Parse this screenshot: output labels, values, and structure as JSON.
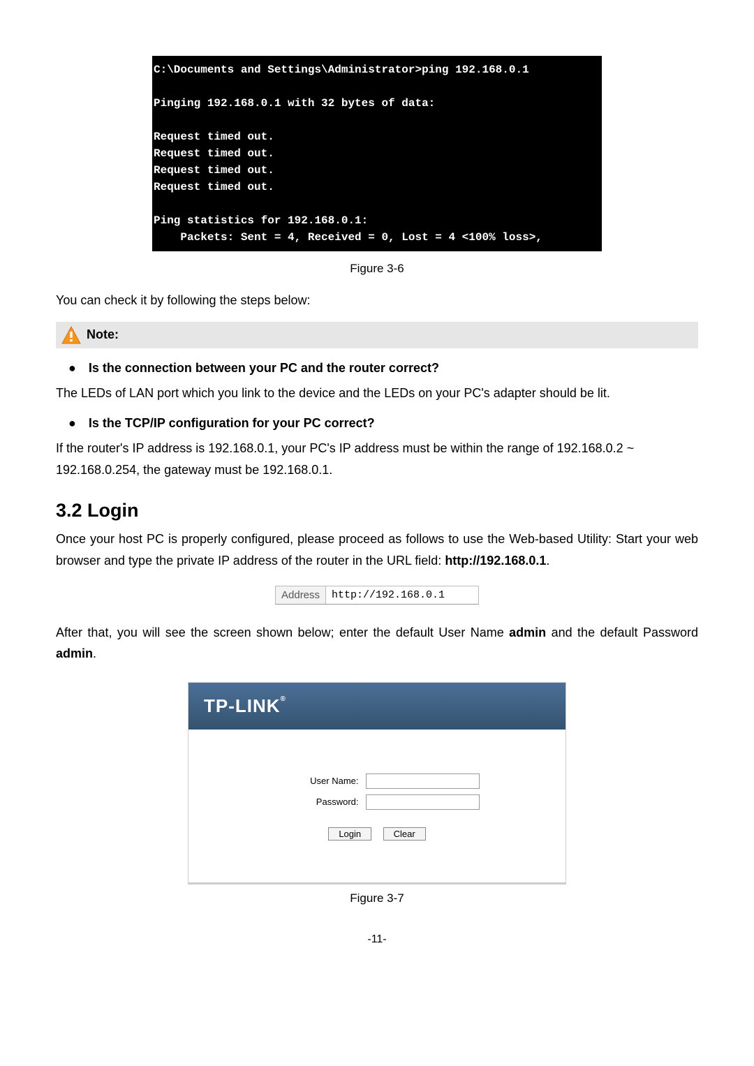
{
  "terminal": {
    "line1": "C:\\Documents and Settings\\Administrator>ping 192.168.0.1",
    "blank1": "",
    "line2": "Pinging 192.168.0.1 with 32 bytes of data:",
    "blank2": "",
    "line3": "Request timed out.",
    "line4": "Request timed out.",
    "line5": "Request timed out.",
    "line6": "Request timed out.",
    "blank3": "",
    "line7": "Ping statistics for 192.168.0.1:",
    "line8": "    Packets: Sent = 4, Received = 0, Lost = 4 <100% loss>,"
  },
  "captions": {
    "fig36": "Figure 3-6",
    "fig37": "Figure 3-7"
  },
  "text": {
    "checkSteps": "You can check it by following the steps below:",
    "noteLabel": "Note:",
    "q1": "Is the connection between your PC and the router correct?",
    "a1": "The LEDs of LAN port which you link to the device and the LEDs on your PC's adapter should be lit.",
    "q2": "Is the TCP/IP configuration for your PC correct?",
    "a2": "If the router's IP address is 192.168.0.1, your PC's IP address must be within the range of 192.168.0.2 ~ 192.168.0.254, the gateway must be 192.168.0.1.",
    "sectionHeading": "3.2  Login",
    "para1_a": "Once your host PC is properly configured, please proceed as follows to use the Web-based Utility: Start your web browser and type the private IP address of the router in the URL field: ",
    "para1_bold": "http://192.168.0.1",
    "period": ".",
    "addrLabel": "Address",
    "addrUrl": "http://192.168.0.1",
    "para2_a": "After that, you will see the screen shown below; enter the default User Name ",
    "para2_b1": "admin",
    "para2_b": " and the default Password ",
    "para2_b2": "admin",
    "brand": "TP-LINK",
    "userNameLabel": "User Name:",
    "passwordLabel": "Password:",
    "loginBtn": "Login",
    "clearBtn": "Clear",
    "pageNumber": "-11-"
  }
}
